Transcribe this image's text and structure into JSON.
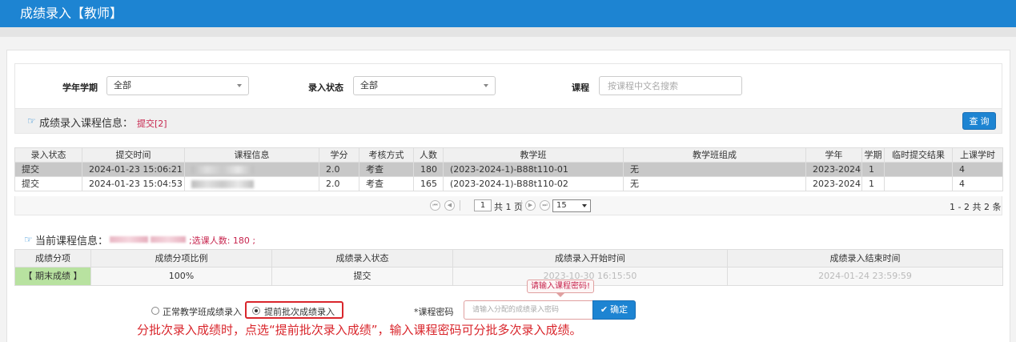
{
  "app": {
    "title": "成绩录入【教师】"
  },
  "filters": {
    "year_term": {
      "label": "学年学期",
      "value": "全部"
    },
    "entry_status": {
      "label": "录入状态",
      "value": "全部"
    },
    "course": {
      "label": "课程",
      "placeholder": "按课程中文名搜索"
    },
    "query_button": "查 询"
  },
  "course_info": {
    "title": "成绩录入课程信息：",
    "submit_link": "提交[2]",
    "columns": [
      "录入状态",
      "提交时间",
      "课程信息",
      "学分",
      "考核方式",
      "人数",
      "教学班",
      "教学班组成",
      "学年",
      "学期",
      "临时提交结果",
      "上课学时"
    ],
    "rows": [
      {
        "status": "提交",
        "time": "2024-01-23 15:06:21",
        "credit": "2.0",
        "assess": "考查",
        "count": "180",
        "class": "(2023-2024-1)-B88t110-01",
        "composition": "无",
        "year": "2023-2024",
        "term": "1",
        "temp_result": "",
        "hours": "4"
      },
      {
        "status": "提交",
        "time": "2024-01-23 15:04:53",
        "credit": "2.0",
        "assess": "考查",
        "count": "165",
        "class": "(2023-2024-1)-B88t110-02",
        "composition": "无",
        "year": "2023-2024",
        "term": "1",
        "temp_result": "",
        "hours": "4"
      }
    ]
  },
  "pager": {
    "page": "1",
    "total_pages": "共 1 页",
    "page_size": "15",
    "summary": "1 - 2   共 2 条"
  },
  "current_course": {
    "title": "当前课程信息：",
    "enrolled": ";选课人数: 180 ;",
    "columns": [
      "成绩分项",
      "成绩分项比例",
      "成绩录入状态",
      "成绩录入开始时间",
      "成绩录入结束时间"
    ],
    "row": {
      "item": "【 期末成绩 】",
      "ratio": "100%",
      "status": "提交",
      "start": "2023-10-30 16:15:50",
      "end": "2024-01-24 23:59:59"
    }
  },
  "entry_mode": {
    "normal_label": "正常教学班成绩录入",
    "early_label": "提前批次成绩录入",
    "password_label": "*课程密码",
    "password_placeholder": "请输入分配的成绩录入密码",
    "confirm_button": "确定",
    "tooltip": "请输入课程密码!"
  },
  "annotation": "分批次录入成绩时，点选“提前批次录入成绩”，输入课程密码可分批多次录入成绩。",
  "colors": {
    "header_blue": "#1d84d2",
    "accent_red": "#d9262c",
    "green_cell": "#b8e2a0"
  }
}
